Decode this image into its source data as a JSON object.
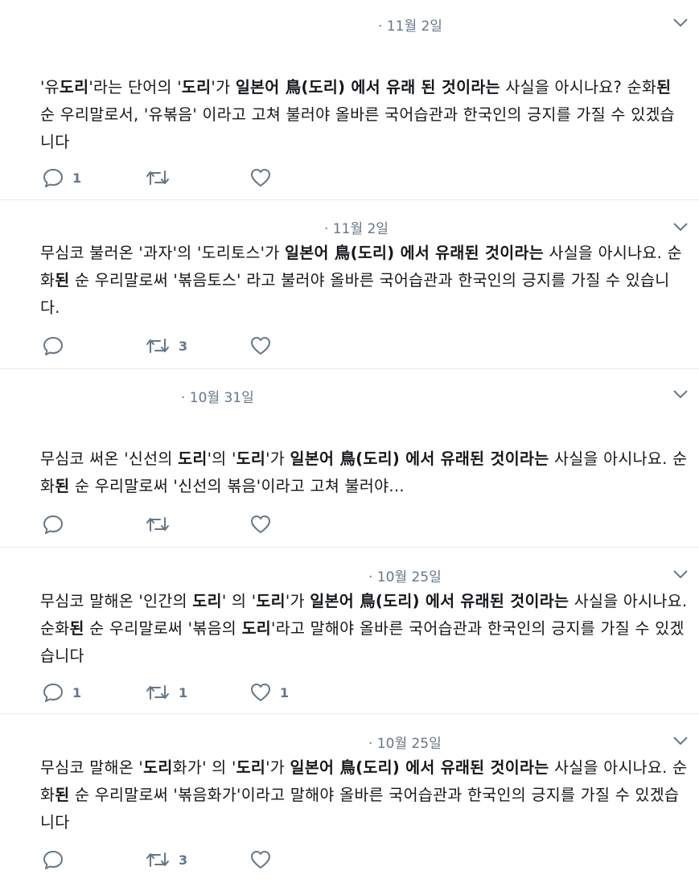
{
  "tweets": [
    {
      "date": "· 11월 2일",
      "body": [
        {
          "t": "'유"
        },
        {
          "t": "도리",
          "b": true
        },
        {
          "t": "'라는 단어의 '"
        },
        {
          "t": "도리",
          "b": true
        },
        {
          "t": "'가 "
        },
        {
          "t": "일본어 鳥(도리) 에서 유래 된 것이라는",
          "b": true
        },
        {
          "t": " 사실을 아시나요? 순화"
        },
        {
          "t": "된",
          "b": true
        },
        {
          "t": " 순 우리말로서, '유볶음' 이라고 고쳐 불러야 올바른 국어습관과 한국인의 긍지를 가질 수 있겠습니다"
        }
      ],
      "reply_count": "1",
      "retweet_count": "",
      "like_count": ""
    },
    {
      "date": "· 11월 2일",
      "body": [
        {
          "t": "무심코 불러온 '과자'의 '도리토스'가 "
        },
        {
          "t": "일본어 鳥(도리) 에서 유래된 것이라는",
          "b": true
        },
        {
          "t": " 사실을 아시나요. 순화"
        },
        {
          "t": "된",
          "b": true
        },
        {
          "t": " 순 우리말로써 '볶음토스' 라고 불러야 올바른 국어습관과 한국인의 긍지를 가질 수 있습니다."
        }
      ],
      "reply_count": "",
      "retweet_count": "3",
      "like_count": ""
    },
    {
      "date": "· 10월 31일",
      "body": [
        {
          "t": "무심코 써온 '신선의 "
        },
        {
          "t": "도리",
          "b": true
        },
        {
          "t": "'의 '"
        },
        {
          "t": "도리",
          "b": true
        },
        {
          "t": "'가 "
        },
        {
          "t": "일본어 鳥(도리) 에서 유래된 것이라는",
          "b": true
        },
        {
          "t": " 사실을 아시나요. 순화"
        },
        {
          "t": "된",
          "b": true
        },
        {
          "t": " 순 우리말로써 '신선의 볶음'이라고 고쳐 불러야..."
        }
      ],
      "reply_count": "",
      "retweet_count": "",
      "like_count": ""
    },
    {
      "date": "· 10월 25일",
      "body": [
        {
          "t": "무심코 말해온 '인간의 "
        },
        {
          "t": "도리",
          "b": true
        },
        {
          "t": "' 의 '"
        },
        {
          "t": "도리",
          "b": true
        },
        {
          "t": "'가 "
        },
        {
          "t": "일본어 鳥(도리) 에서 유래된 것이라는",
          "b": true
        },
        {
          "t": " 사실을 아시나요. 순화"
        },
        {
          "t": "된",
          "b": true
        },
        {
          "t": " 순 우리말로써 '볶음의 "
        },
        {
          "t": "도리",
          "b": true
        },
        {
          "t": "'라고 말해야 올바른 국어습관과 한국인의 긍지를 가질 수 있겠습니다"
        }
      ],
      "reply_count": "1",
      "retweet_count": "1",
      "like_count": "1"
    },
    {
      "date": "· 10월 25일",
      "body": [
        {
          "t": "무심코 말해온 '"
        },
        {
          "t": "도리",
          "b": true
        },
        {
          "t": "화가' 의 '"
        },
        {
          "t": "도리",
          "b": true
        },
        {
          "t": "'가 "
        },
        {
          "t": "일본어 鳥(도리) 에서 유래된 것이라는",
          "b": true
        },
        {
          "t": " 사실을 아시나요. 순화"
        },
        {
          "t": "된",
          "b": true
        },
        {
          "t": " 순 우리말로써 '볶음화가'이라고 말해야 올바른 국어습관과 한국인의 긍지를 가질 수 있겠습니다"
        }
      ],
      "reply_count": "",
      "retweet_count": "3",
      "like_count": ""
    }
  ],
  "colors": {
    "icon": "#657786",
    "divider": "#e6ecf0",
    "text": "#14171a"
  },
  "icons": [
    "reply-icon",
    "retweet-icon",
    "like-icon",
    "chevron-down-icon"
  ]
}
